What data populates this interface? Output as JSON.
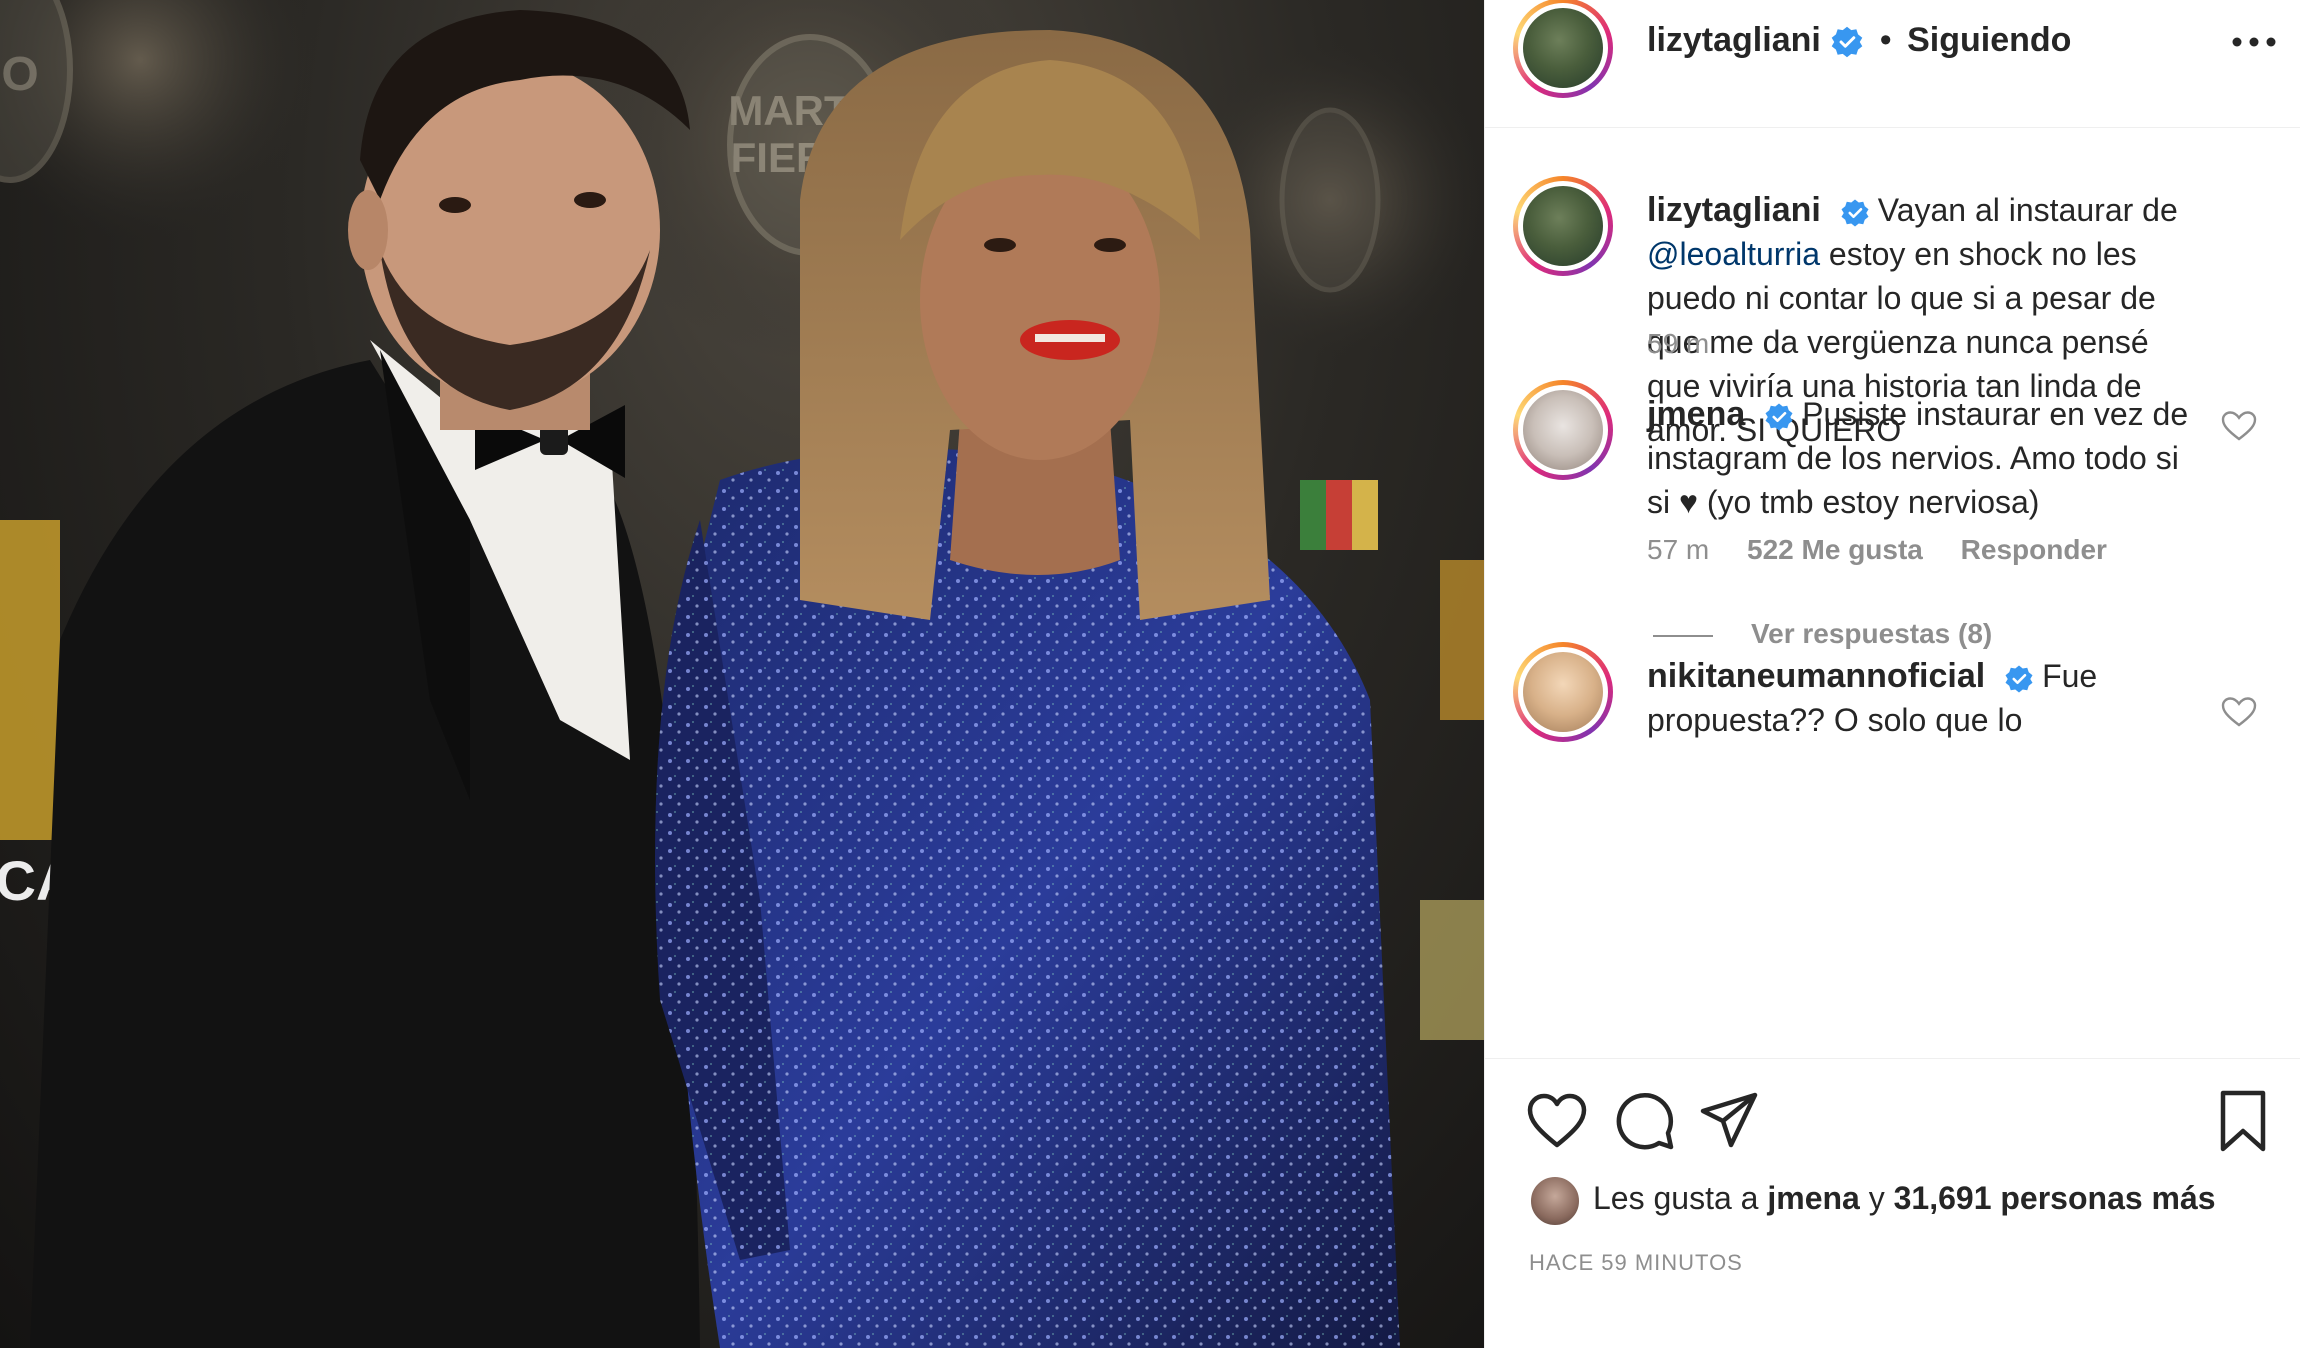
{
  "post": {
    "author": "lizytagliani",
    "follow_status": "Siguiendo",
    "separator": "•",
    "caption": {
      "author": "lizytagliani",
      "text_before": "Vayan al instaurar de ",
      "mention": "@leoalturria",
      "text_after": " estoy en shock no les puedo ni contar lo que si a pesar de que me da vergüenza nunca pensé que viviría una historia tan linda de amor. SI QUIERO",
      "time": "59 m"
    }
  },
  "comments": [
    {
      "author": "jmena",
      "text": "Pusiste instaurar en vez de instagram de los nervios. Amo todo si si ♥ (yo tmb estoy nerviosa)",
      "time": "57 m",
      "likes": "522 Me gusta",
      "reply": "Responder",
      "view_replies": "Ver respuestas (8)"
    },
    {
      "author": "nikitaneumannoficial",
      "text": "Fue propuesta?? O solo que lo"
    }
  ],
  "likes": {
    "prefix": "Les gusta a ",
    "user": "jmena",
    "middle": " y ",
    "count": "31,691 personas más"
  },
  "timestamp": "HACE 59 MINUTOS",
  "photo": {
    "backdrop_text_line1": "MARTIN",
    "backdrop_text_line2": "FIERRO",
    "backdrop_text_side": "O",
    "backdrop_text_left": "ICA"
  },
  "colors": {
    "verified_blue": "#3897f0",
    "text_primary": "#262626",
    "text_secondary": "#8e8e8e",
    "mention": "#00376b"
  }
}
